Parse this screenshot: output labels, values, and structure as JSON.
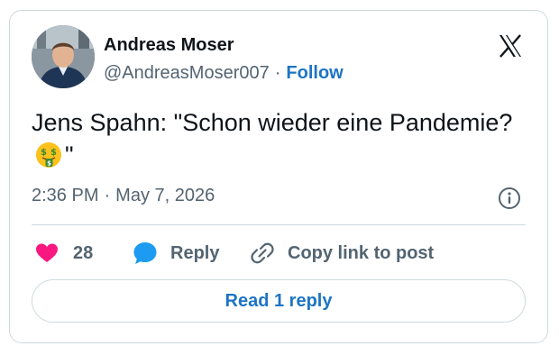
{
  "author": {
    "name": "Andreas Moser",
    "handle": "@AndreasMoser007",
    "separator": "·",
    "follow_label": "Follow"
  },
  "tweet": {
    "text_before_emoji": "Jens Spahn: \"Schon wieder eine Pandemie?",
    "emoji_name": "money-mouth-face-icon",
    "text_after_emoji": "\""
  },
  "meta": {
    "time": "2:36 PM",
    "separator": "·",
    "date": "May 7, 2026"
  },
  "actions": {
    "like_count": "28",
    "reply_label": "Reply",
    "copy_label": "Copy link to post"
  },
  "read_replies_label": "Read 1 reply",
  "colors": {
    "accent": "#1d74c4",
    "heart": "#f91880",
    "reply_bubble": "#1d9bf0",
    "muted": "#536471",
    "border": "#cfd9de"
  }
}
